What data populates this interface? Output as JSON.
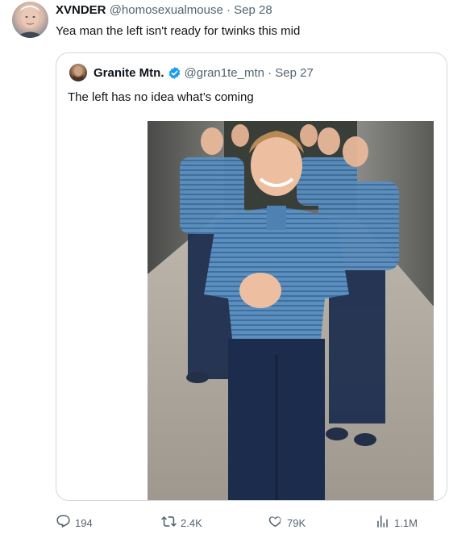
{
  "tweet": {
    "display_name": "XVNDER",
    "handle_time": "@homosexualmouse · Sep 28",
    "text": "Yea man the left isn't ready for twinks this mid"
  },
  "quote": {
    "display_name": "Granite Mtn.",
    "handle_time": "@gran1te_mtn · Sep 27",
    "text": "The left has no idea what’s coming",
    "verified_color": "#1d9bf0"
  },
  "actions": {
    "replies": "194",
    "reposts": "2.4K",
    "likes": "79K",
    "views": "1.1M"
  },
  "icons": [
    "reply-icon",
    "repost-icon",
    "like-icon",
    "views-icon",
    "verified-badge-icon"
  ]
}
